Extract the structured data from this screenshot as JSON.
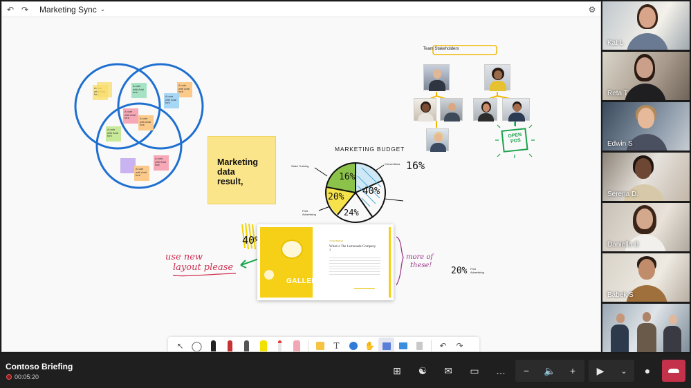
{
  "whiteboard": {
    "title": "Marketing Sync",
    "undo_icon": "undo-icon",
    "redo_icon": "redo-icon",
    "settings_icon": "gear-icon",
    "big_note": [
      "Marketing",
      "data",
      "result,"
    ],
    "sticky_text": "A note with Arial font",
    "team_label": "Team Stakeholders",
    "open_pos": [
      "OPEN",
      "POS"
    ],
    "budget_title": "MARKETING BUDGET",
    "pie_slices": [
      "16%",
      "40%",
      "24%",
      "20%"
    ],
    "pie_callouts": {
      "left_top": "Sales Training",
      "right_top": "Conventions",
      "left_bottom": "Print Advertising"
    },
    "percent_16": "16%",
    "percent_40": "40%",
    "percent_20": "20%",
    "print_advertising": "Print Advertising",
    "annotation_left": [
      "use new",
      "layout please"
    ],
    "annotation_right": [
      "more of",
      "these!"
    ],
    "card": {
      "tag": "YOUR BRAND",
      "question": "What is The Lemonade Company ?",
      "gallery": "GALLERY"
    }
  },
  "toolbar": {
    "tools": [
      {
        "name": "select-tool",
        "icon": "pointer-icon"
      },
      {
        "name": "lasso-tool",
        "icon": "lasso-icon"
      },
      {
        "name": "black-pen",
        "color": "#222222"
      },
      {
        "name": "red-pen",
        "color": "#c83232"
      },
      {
        "name": "gray-pen",
        "color": "#555555"
      },
      {
        "name": "highlighter",
        "color": "#f2e000"
      },
      {
        "name": "laser-pointer",
        "color": "#e23c3c"
      },
      {
        "name": "eraser",
        "color": "#f2a7b4"
      },
      {
        "name": "sticky-note-tool",
        "icon": "sticky-note-icon"
      },
      {
        "name": "text-tool",
        "icon": "text-icon"
      },
      {
        "name": "shapes-tool",
        "icon": "shapes-icon"
      },
      {
        "name": "reactions-tool",
        "icon": "thumbs-up-icon"
      },
      {
        "name": "templates-tool",
        "icon": "template-icon"
      },
      {
        "name": "image-tool",
        "icon": "image-icon"
      },
      {
        "name": "document-tool",
        "icon": "document-icon"
      },
      {
        "name": "undo-tool",
        "icon": "undo-icon"
      },
      {
        "name": "redo-tool",
        "icon": "redo-icon"
      }
    ]
  },
  "participants": [
    {
      "name": "Kat L"
    },
    {
      "name": "Reta T"
    },
    {
      "name": "Edwin S"
    },
    {
      "name": "Serena D."
    },
    {
      "name": "Daniella B"
    },
    {
      "name": "Babek S"
    },
    {
      "name": ""
    }
  ],
  "meeting": {
    "title": "Contoso Briefing",
    "elapsed": "00:05:20",
    "controls": [
      "grid-view-icon",
      "people-icon",
      "chat-icon",
      "share-screen-icon",
      "more-icon",
      "zoom-out-icon",
      "speaker-icon",
      "zoom-in-icon",
      "camera-icon",
      "chevron-down-icon",
      "microphone-icon",
      "hang-up-icon"
    ]
  },
  "colors": {
    "venn": "#1e6fd0",
    "accent_yellow": "#f6d016",
    "hangup_red": "#c4314b"
  }
}
